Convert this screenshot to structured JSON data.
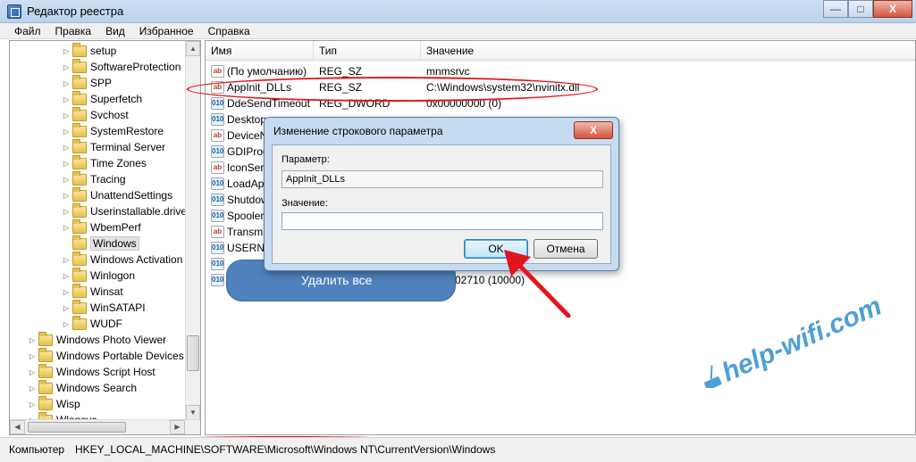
{
  "window": {
    "title": "Редактор реестра",
    "minimize": "—",
    "maximize": "□",
    "close": "X"
  },
  "menu": [
    "Файл",
    "Правка",
    "Вид",
    "Избранное",
    "Справка"
  ],
  "tree": {
    "items": [
      {
        "label": "setup",
        "indent": 2,
        "expandable": true
      },
      {
        "label": "SoftwareProtection",
        "indent": 2,
        "expandable": true
      },
      {
        "label": "SPP",
        "indent": 2,
        "expandable": true
      },
      {
        "label": "Superfetch",
        "indent": 2,
        "expandable": true
      },
      {
        "label": "Svchost",
        "indent": 2,
        "expandable": true
      },
      {
        "label": "SystemRestore",
        "indent": 2,
        "expandable": true
      },
      {
        "label": "Terminal Server",
        "indent": 2,
        "expandable": true
      },
      {
        "label": "Time Zones",
        "indent": 2,
        "expandable": true
      },
      {
        "label": "Tracing",
        "indent": 2,
        "expandable": true
      },
      {
        "label": "UnattendSettings",
        "indent": 2,
        "expandable": true
      },
      {
        "label": "Userinstallable.drive",
        "indent": 2,
        "expandable": true
      },
      {
        "label": "WbemPerf",
        "indent": 2,
        "expandable": true
      },
      {
        "label": "Windows",
        "indent": 2,
        "expandable": false,
        "selected": true
      },
      {
        "label": "Windows Activation",
        "indent": 2,
        "expandable": true
      },
      {
        "label": "Winlogon",
        "indent": 2,
        "expandable": true
      },
      {
        "label": "Winsat",
        "indent": 2,
        "expandable": true
      },
      {
        "label": "WinSATAPI",
        "indent": 2,
        "expandable": true
      },
      {
        "label": "WUDF",
        "indent": 2,
        "expandable": true
      },
      {
        "label": "Windows Photo Viewer",
        "indent": 0,
        "expandable": true
      },
      {
        "label": "Windows Portable Devices",
        "indent": 0,
        "expandable": true
      },
      {
        "label": "Windows Script Host",
        "indent": 0,
        "expandable": true
      },
      {
        "label": "Windows Search",
        "indent": 0,
        "expandable": true
      },
      {
        "label": "Wisp",
        "indent": 0,
        "expandable": true
      },
      {
        "label": "Wlansvc",
        "indent": 0,
        "expandable": true
      }
    ]
  },
  "columns": {
    "name": "Имя",
    "type": "Тип",
    "value": "Значение"
  },
  "values": [
    {
      "icon": "ab",
      "kind": "sz",
      "name": "(По умолчанию)",
      "type": "REG_SZ",
      "value": "mnmsrvc"
    },
    {
      "icon": "ab",
      "kind": "sz",
      "name": "AppInit_DLLs",
      "type": "REG_SZ",
      "value": "C:\\Windows\\system32\\nvinitx.dll"
    },
    {
      "icon": "010",
      "kind": "dw",
      "name": "DdeSendTimeout",
      "type": "REG_DWORD",
      "value": "0x00000000 (0)"
    },
    {
      "icon": "010",
      "kind": "dw",
      "name": "Desktop",
      "type": "",
      "value": ""
    },
    {
      "icon": "ab",
      "kind": "sz",
      "name": "DeviceN",
      "type": "",
      "value": ""
    },
    {
      "icon": "010",
      "kind": "dw",
      "name": "GDIProc",
      "type": "",
      "value": ""
    },
    {
      "icon": "ab",
      "kind": "sz",
      "name": "IconServ",
      "type": "",
      "value": ""
    },
    {
      "icon": "010",
      "kind": "dw",
      "name": "LoadApp",
      "type": "",
      "value": ""
    },
    {
      "icon": "010",
      "kind": "dw",
      "name": "Shutdow",
      "type": "",
      "value": ""
    },
    {
      "icon": "010",
      "kind": "dw",
      "name": "Spooler",
      "type": "",
      "value": ""
    },
    {
      "icon": "ab",
      "kind": "sz",
      "name": "Transmi",
      "type": "",
      "value": ""
    },
    {
      "icon": "010",
      "kind": "dw",
      "name": "USERNe",
      "type": "",
      "value": ""
    },
    {
      "icon": "010",
      "kind": "dw",
      "name": "",
      "type": "",
      "value": "02710 (10000)"
    },
    {
      "icon": "010",
      "kind": "dw",
      "name": "",
      "type": "",
      "value": "02710 (10000)"
    }
  ],
  "dialog": {
    "title": "Изменение строкового параметра",
    "close": "X",
    "param_label": "Параметр:",
    "param_value": "AppInit_DLLs",
    "value_label": "Значение:",
    "value_input": "",
    "ok": "OK",
    "cancel": "Отмена"
  },
  "callout": {
    "text": "Удалить все"
  },
  "status": {
    "label": "Компьютер",
    "path": "HKEY_LOCAL_MACHINE\\SOFTWARE\\Microsoft\\Windows NT\\CurrentVersion\\Windows"
  },
  "watermark": {
    "text": "help-wifi.com"
  },
  "colors": {
    "highlight": "#e4141b",
    "callout": "#4f81bd"
  }
}
